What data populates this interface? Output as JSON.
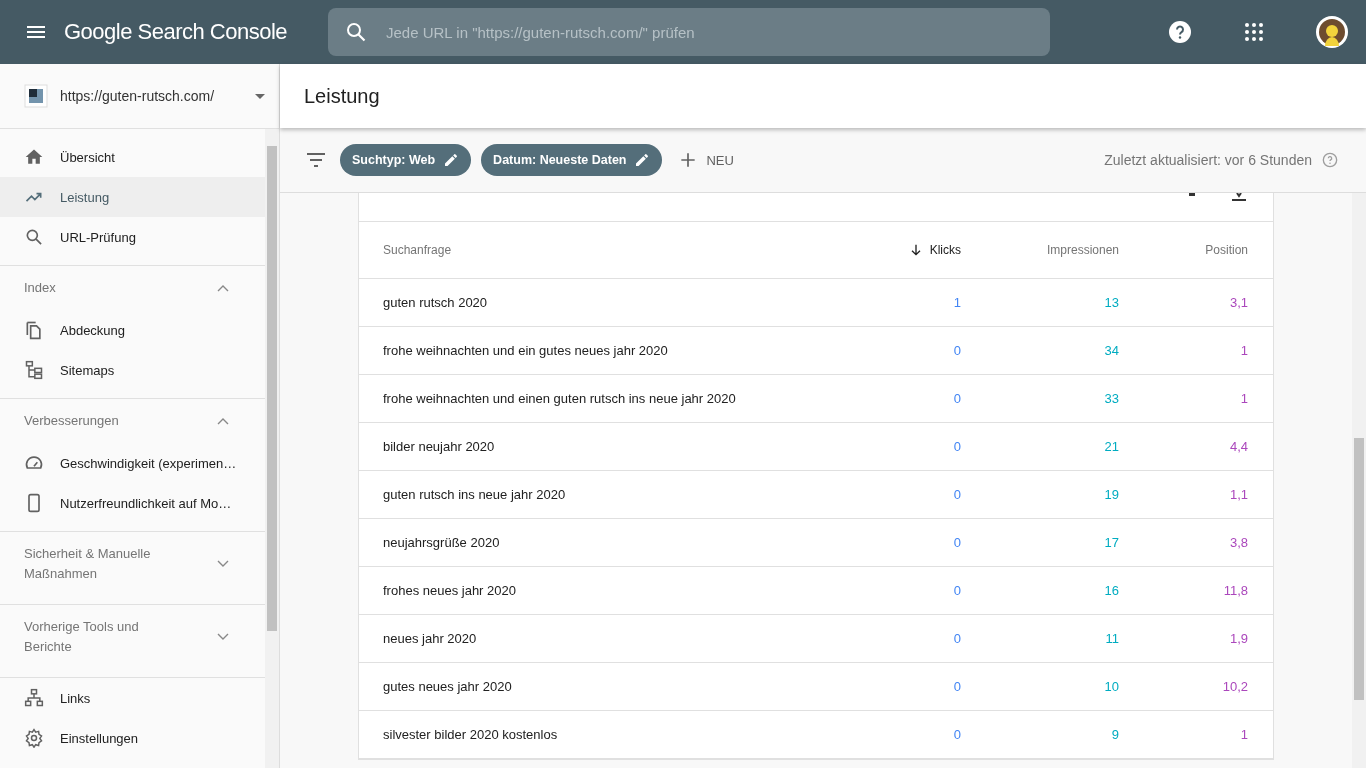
{
  "header": {
    "logo": "Google Search Console",
    "search_placeholder": "Jede URL in \"https://guten-rutsch.com/\" prüfen"
  },
  "sidebar": {
    "property": "https://guten-rutsch.com/",
    "groups": [
      {
        "items": [
          {
            "label": "Übersicht",
            "selected": false
          },
          {
            "label": "Leistung",
            "selected": true
          },
          {
            "label": "URL-Prüfung",
            "selected": false
          }
        ]
      },
      {
        "title": "Index",
        "expanded": true,
        "items": [
          {
            "label": "Abdeckung",
            "selected": false
          },
          {
            "label": "Sitemaps",
            "selected": false
          }
        ]
      },
      {
        "title": "Verbesserungen",
        "expanded": true,
        "items": [
          {
            "label": "Geschwindigkeit (experimen…",
            "selected": false
          },
          {
            "label": "Nutzerfreundlichkeit auf Mo…",
            "selected": false
          }
        ]
      },
      {
        "title": "Sicherheit & Manuelle Maßnahmen",
        "expanded": false
      },
      {
        "title": "Vorherige Tools und Berichte",
        "expanded": false
      },
      {
        "items": [
          {
            "label": "Links",
            "selected": false
          },
          {
            "label": "Einstellungen",
            "selected": false
          }
        ]
      }
    ]
  },
  "page_title": "Leistung",
  "filters": {
    "chips": [
      "Suchtyp: Web",
      "Datum: Neueste Daten"
    ],
    "new_label": "NEU",
    "updated": "Zuletzt aktualisiert: vor 6 Stunden"
  },
  "table": {
    "columns": [
      {
        "label": "Suchanfrage",
        "sorted": false
      },
      {
        "label": "Klicks",
        "sorted": true,
        "color": "#4285f4"
      },
      {
        "label": "Impressionen",
        "sorted": false,
        "color": "#00acc1"
      },
      {
        "label": "Position",
        "sorted": false,
        "color": "#ab47bc"
      }
    ],
    "rows": [
      [
        "guten rutsch 2020",
        "1",
        "13",
        "3,1"
      ],
      [
        "frohe weihnachten und ein gutes neues jahr 2020",
        "0",
        "34",
        "1"
      ],
      [
        "frohe weihnachten und einen guten rutsch ins neue jahr 2020",
        "0",
        "33",
        "1"
      ],
      [
        "bilder neujahr 2020",
        "0",
        "21",
        "4,4"
      ],
      [
        "guten rutsch ins neue jahr 2020",
        "0",
        "19",
        "1,1"
      ],
      [
        "neujahrsgrüße 2020",
        "0",
        "17",
        "3,8"
      ],
      [
        "frohes neues jahr 2020",
        "0",
        "16",
        "11,8"
      ],
      [
        "neues jahr 2020",
        "0",
        "11",
        "1,9"
      ],
      [
        "gutes neues jahr 2020",
        "0",
        "10",
        "10,2"
      ],
      [
        "silvester bilder 2020 kostenlos",
        "0",
        "9",
        "1"
      ]
    ]
  }
}
